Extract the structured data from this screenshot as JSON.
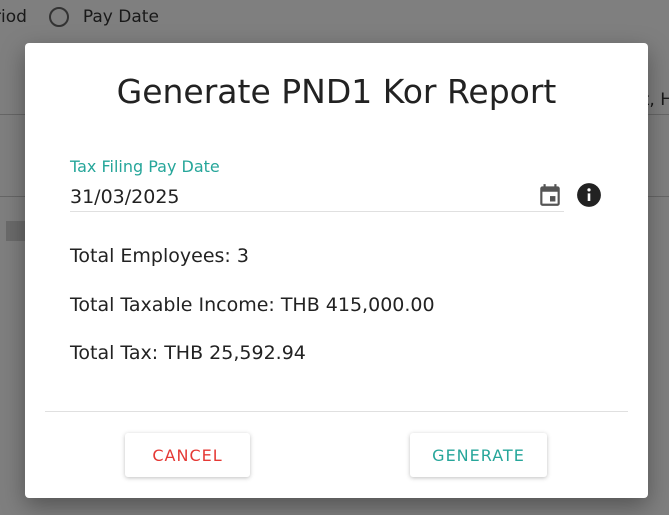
{
  "background": {
    "radio_left_label": "riod",
    "radio_pay_date_label": "Pay Date",
    "right_edge_text": "t, H"
  },
  "dialog": {
    "title": "Generate PND1 Kor Report",
    "date_field": {
      "label": "Tax Filing Pay Date",
      "value": "31/03/2025"
    },
    "stats": {
      "total_employees": "Total Employees: 3",
      "total_taxable_income": "Total Taxable Income: THB 415,000.00",
      "total_tax": "Total Tax: THB 25,592.94"
    },
    "buttons": {
      "cancel": "CANCEL",
      "generate": "GENERATE"
    }
  },
  "colors": {
    "accent": "#26a69a",
    "danger": "#e53935"
  },
  "icons": {
    "calendar": "calendar-icon",
    "info": "info-icon"
  }
}
